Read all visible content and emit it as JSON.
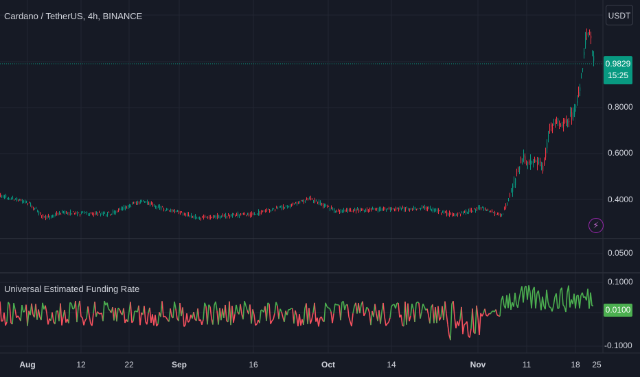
{
  "header": {
    "symbol_title": "Cardano / TetherUS, 4h, BINANCE",
    "currency_button": "USDT"
  },
  "price_axis": {
    "last_price": "0.9829",
    "countdown": "15:25",
    "ticks": [
      "0.8000",
      "0.6000",
      "0.4000"
    ]
  },
  "extra_pane": {
    "tick": "0.0500"
  },
  "indicator": {
    "title": "Universal Estimated Funding Rate",
    "current_value": "0.0100",
    "ticks": [
      "0.1000",
      "-0.1000"
    ]
  },
  "time_axis": {
    "ticks": [
      {
        "label": "Aug",
        "major": true
      },
      {
        "label": "12",
        "major": false
      },
      {
        "label": "22",
        "major": false
      },
      {
        "label": "Sep",
        "major": true
      },
      {
        "label": "16",
        "major": false
      },
      {
        "label": "Oct",
        "major": true
      },
      {
        "label": "14",
        "major": false
      },
      {
        "label": "Nov",
        "major": true
      },
      {
        "label": "11",
        "major": false
      },
      {
        "label": "18",
        "major": false
      },
      {
        "label": "25",
        "major": false
      }
    ]
  },
  "colors": {
    "background": "#161a25",
    "up": "#089981",
    "down": "#f23645",
    "funding_positive": "#4caf50",
    "funding_negative": "#f7525f"
  },
  "icons": {
    "alert": "lightning-bolt-icon"
  }
}
